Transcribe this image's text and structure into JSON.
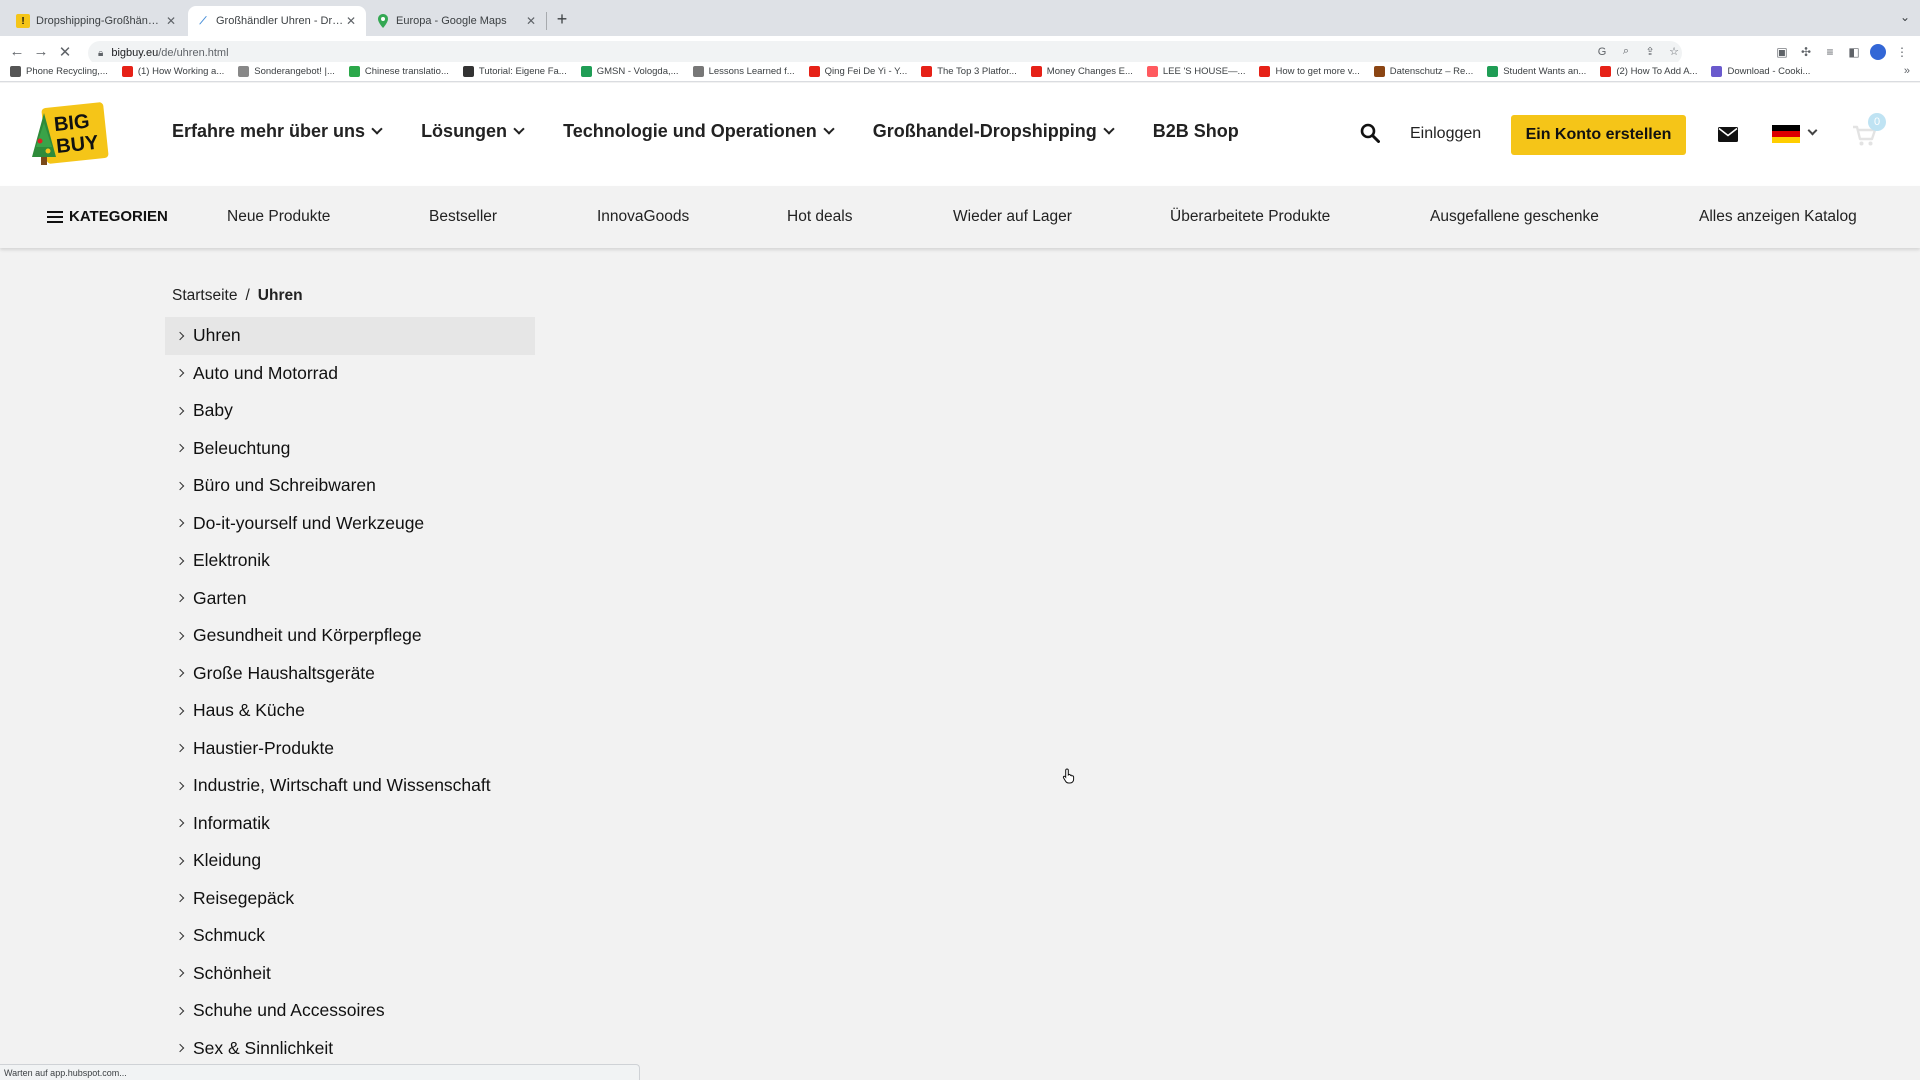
{
  "browser": {
    "tabs": [
      {
        "title": "Dropshipping-Großhändler. Bi",
        "favicon": "bigbuy-icon",
        "active": false
      },
      {
        "title": "Großhändler Uhren - Dropship",
        "favicon": "bigbuy-icon",
        "active": true
      },
      {
        "title": "Europa - Google Maps",
        "favicon": "maps-pin-icon",
        "active": false
      }
    ],
    "url_host": "bigbuy.eu",
    "url_path": "/de/uhren.html",
    "bookmarks": [
      "Phone Recycling,...",
      "(1) How Working a...",
      "Sonderangebot! |...",
      "Chinese translatio...",
      "Tutorial: Eigene Fa...",
      "GMSN - Vologda,...",
      "Lessons Learned f...",
      "Qing Fei De Yi - Y...",
      "The Top 3 Platfor...",
      "Money Changes E...",
      "LEE 'S HOUSE—...",
      "How to get more v...",
      "Datenschutz – Re...",
      "Student Wants an...",
      "(2) How To Add A...",
      "Download - Cooki..."
    ],
    "status_text": "Warten auf app.hubspot.com..."
  },
  "header": {
    "logo_text": "BIG BUY",
    "nav": [
      {
        "label": "Erfahre mehr über uns",
        "has_dropdown": true
      },
      {
        "label": "Lösungen",
        "has_dropdown": true
      },
      {
        "label": "Technologie und Operationen",
        "has_dropdown": true
      },
      {
        "label": "Großhandel-Dropshipping",
        "has_dropdown": true
      },
      {
        "label": "B2B Shop",
        "has_dropdown": false
      }
    ],
    "login_label": "Einloggen",
    "cta_label": "Ein Konto erstellen",
    "cart_count": "0",
    "brand_color": "#f5c518"
  },
  "catbar": {
    "categories_label": "KATEGORIEN",
    "links": [
      "Neue Produkte",
      "Bestseller",
      "InnovaGoods",
      "Hot deals",
      "Wieder auf Lager",
      "Überarbeitete Produkte",
      "Ausgefallene geschenke",
      "Alles anzeigen Katalog"
    ]
  },
  "breadcrumb": {
    "home": "Startseite",
    "separator": "/",
    "current": "Uhren"
  },
  "categories": [
    "Uhren",
    "Auto und Motorrad",
    "Baby",
    "Beleuchtung",
    "Büro und Schreibwaren",
    "Do-it-yourself und Werkzeuge",
    "Elektronik",
    "Garten",
    "Gesundheit und Körperpflege",
    "Große Haushaltsgeräte",
    "Haus & Küche",
    "Haustier-Produkte",
    "Industrie, Wirtschaft und Wissenschaft",
    "Informatik",
    "Kleidung",
    "Reisegepäck",
    "Schmuck",
    "Schönheit",
    "Schuhe und Accessoires",
    "Sex & Sinnlichkeit"
  ]
}
